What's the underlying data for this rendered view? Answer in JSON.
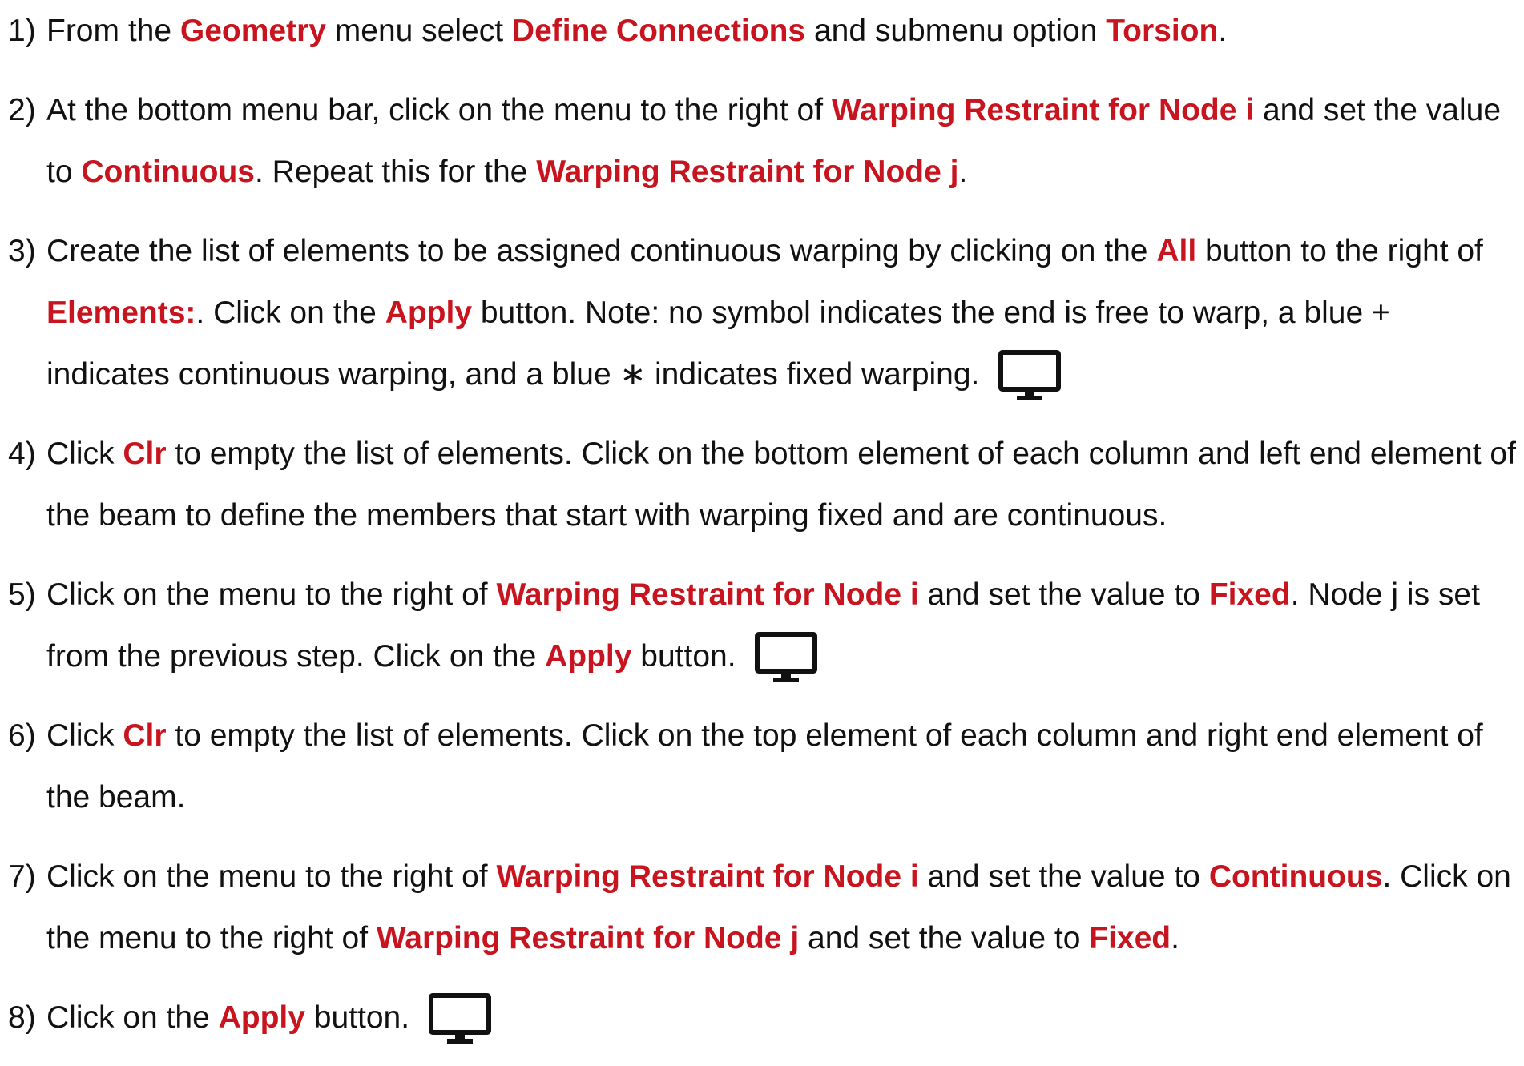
{
  "steps": [
    {
      "number": "1)",
      "segments": [
        {
          "t": "From the "
        },
        {
          "t": "Geometry",
          "h": true
        },
        {
          "t": " menu select "
        },
        {
          "t": "Define Connections",
          "h": true
        },
        {
          "t": " and submenu option "
        },
        {
          "t": "Torsion",
          "h": true
        },
        {
          "t": "."
        }
      ]
    },
    {
      "number": "2)",
      "segments": [
        {
          "t": "At the bottom menu bar, click on the menu to the right of "
        },
        {
          "t": "Warping Restraint for Node i",
          "h": true
        },
        {
          "t": " and set the value to "
        },
        {
          "t": "Continuous",
          "h": true
        },
        {
          "t": ". Repeat this for the "
        },
        {
          "t": "Warping Restraint for Node j",
          "h": true
        },
        {
          "t": "."
        }
      ]
    },
    {
      "number": "3)",
      "segments": [
        {
          "t": "Create the list of elements to be assigned continuous warping by clicking on the "
        },
        {
          "t": "All",
          "h": true
        },
        {
          "t": " button to the right of "
        },
        {
          "t": "Elements:",
          "h": true
        },
        {
          "t": ". Click on the "
        },
        {
          "t": "Apply",
          "h": true
        },
        {
          "t": " button. Note: no symbol indicates the end is free to warp, a blue + indicates continuous warping, and a blue ∗ indicates fixed warping. "
        },
        {
          "icon": "monitor-icon"
        }
      ]
    },
    {
      "number": "4)",
      "segments": [
        {
          "t": "Click "
        },
        {
          "t": "Clr",
          "h": true
        },
        {
          "t": " to empty the list of elements. Click on the bottom element of each column and left end element of the beam to define the members that start with warping fixed and are continuous."
        }
      ]
    },
    {
      "number": "5)",
      "segments": [
        {
          "t": "Click on the menu to the right of "
        },
        {
          "t": "Warping Restraint for Node i",
          "h": true
        },
        {
          "t": " and set the value to "
        },
        {
          "t": "Fixed",
          "h": true
        },
        {
          "t": ". Node j is set from the previous step. Click on the "
        },
        {
          "t": "Apply",
          "h": true
        },
        {
          "t": " button. "
        },
        {
          "icon": "monitor-icon"
        }
      ]
    },
    {
      "number": "6)",
      "segments": [
        {
          "t": "Click "
        },
        {
          "t": "Clr",
          "h": true
        },
        {
          "t": " to empty the list of elements. Click on the top element of each column and right end element of the beam."
        }
      ]
    },
    {
      "number": "7)",
      "segments": [
        {
          "t": "Click on the menu to the right of "
        },
        {
          "t": "Warping Restraint for Node i",
          "h": true
        },
        {
          "t": " and set the value to "
        },
        {
          "t": "Continuous",
          "h": true
        },
        {
          "t": ". Click on the menu to the right of "
        },
        {
          "t": "Warping Restraint for Node j",
          "h": true
        },
        {
          "t": " and set the value to "
        },
        {
          "t": "Fixed",
          "h": true
        },
        {
          "t": "."
        }
      ]
    },
    {
      "number": "8)",
      "segments": [
        {
          "t": "Click on the "
        },
        {
          "t": "Apply",
          "h": true
        },
        {
          "t": " button. "
        },
        {
          "icon": "monitor-icon"
        }
      ]
    }
  ],
  "colors": {
    "highlight": "#c8141e",
    "text": "#111111",
    "background": "#ffffff"
  }
}
